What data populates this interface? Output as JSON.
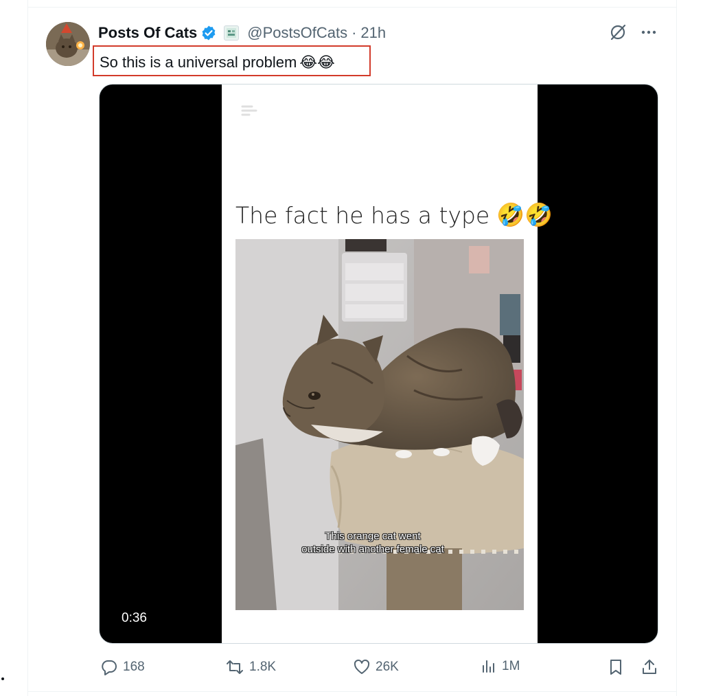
{
  "tweet": {
    "author": {
      "display_name": "Posts Of Cats",
      "handle": "@PostsOfCats",
      "verified_icon": "verified-badge-icon",
      "affiliate_icon": "affiliate-badge-icon"
    },
    "separator": "·",
    "time": "21h",
    "text": "So this is a universal problem",
    "text_emoji": "😂😂"
  },
  "media": {
    "caption": "The fact he has a type",
    "caption_emoji": "🤣🤣",
    "subtitle_line1": "This orange cat went",
    "subtitle_line2": "outside with another female cat",
    "duration": "0:36"
  },
  "actions": {
    "replies": "168",
    "reposts": "1.8K",
    "likes": "26K",
    "views": "1M"
  },
  "colors": {
    "text_primary": "#0f1419",
    "text_secondary": "#536471",
    "verified_blue": "#1d9bf0",
    "highlight_red": "#d23a2a"
  }
}
